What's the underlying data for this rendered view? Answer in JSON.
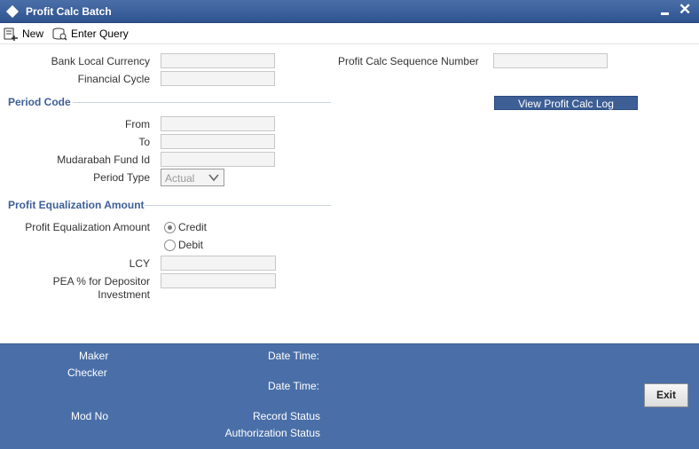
{
  "window": {
    "title": "Profit Calc Batch"
  },
  "toolbar": {
    "new_label": "New",
    "enter_query_label": "Enter Query"
  },
  "form": {
    "bank_local_currency_label": "Bank Local Currency",
    "financial_cycle_label": "Financial Cycle",
    "profit_calc_sequence_label": "Profit Calc Sequence Number",
    "view_log_label": "View Profit Calc Log",
    "period_code_section": "Period Code",
    "from_label": "From",
    "to_label": "To",
    "mudarabah_fund_label": "Mudarabah Fund Id",
    "period_type_label": "Period Type",
    "period_type_value": "Actual",
    "pea_section": "Profit Equalization Amount",
    "pea_label": "Profit Equalization Amount",
    "credit_label": "Credit",
    "debit_label": "Debit",
    "lcy_label": "LCY",
    "pea_pct_label_line1": "PEA % for Depositor",
    "pea_pct_label_line2": "Investment"
  },
  "footer": {
    "maker_label": "Maker",
    "checker_label": "Checker",
    "datetime1_label": "Date Time:",
    "datetime2_label": "Date Time:",
    "modno_label": "Mod No",
    "record_status_label": "Record Status",
    "auth_status_label": "Authorization Status",
    "exit_label": "Exit"
  }
}
